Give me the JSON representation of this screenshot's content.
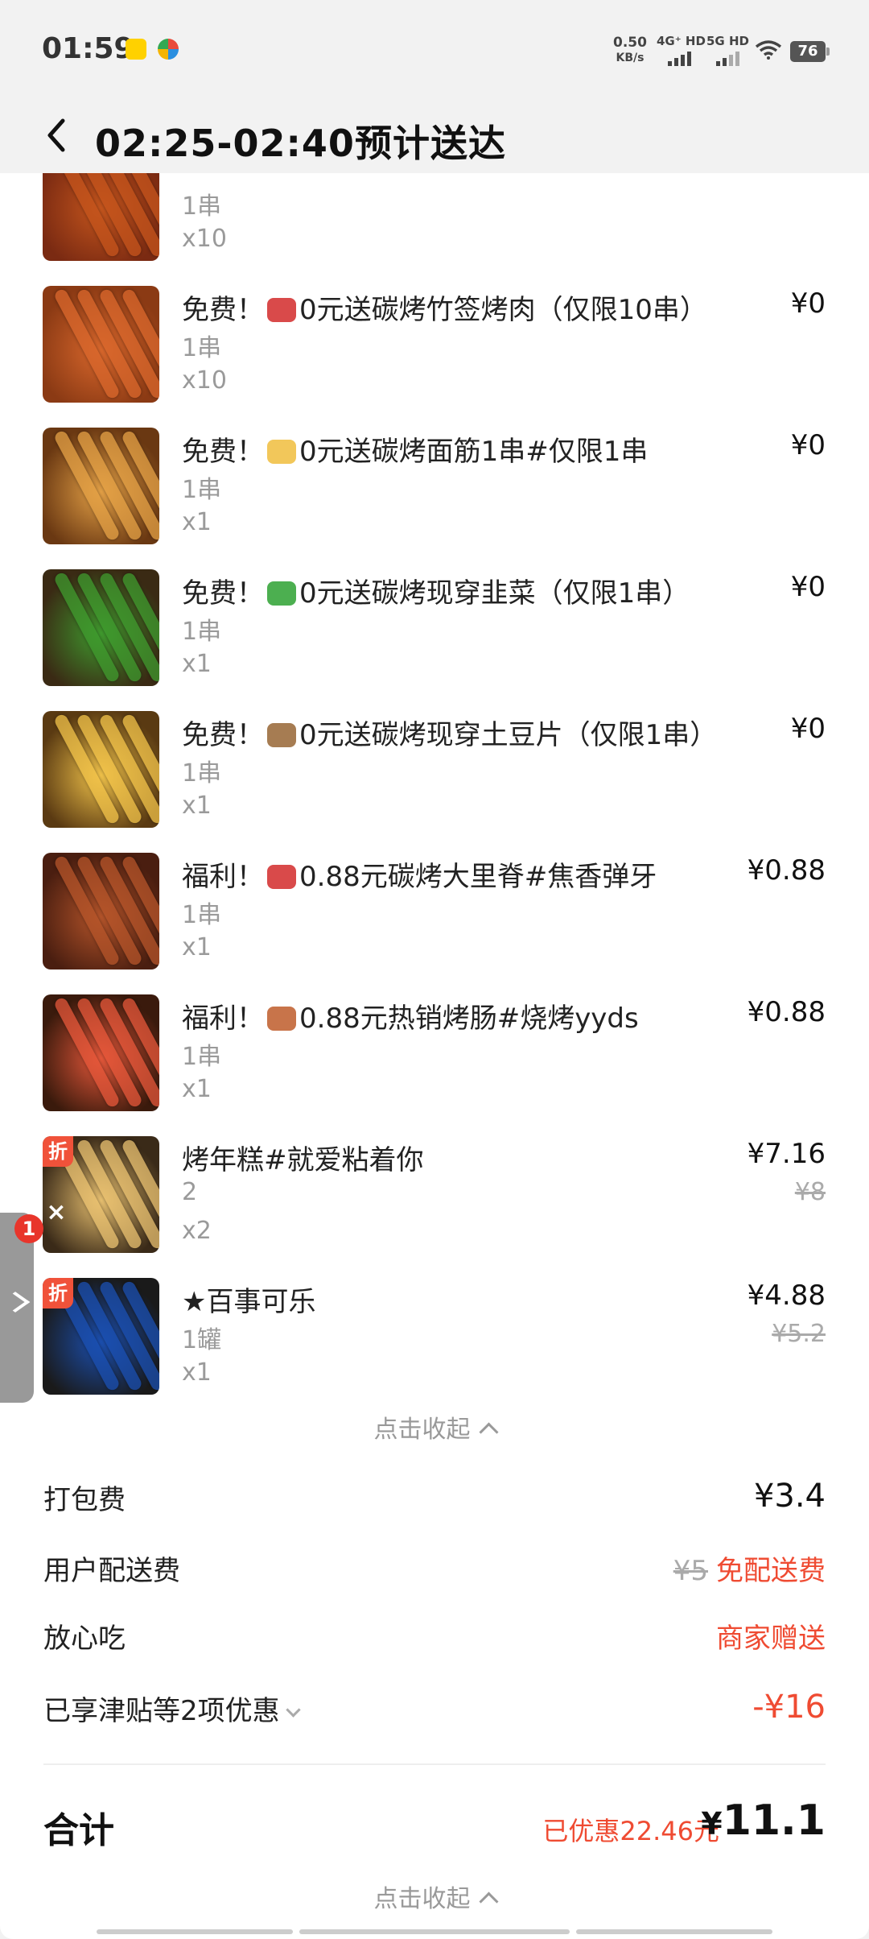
{
  "status_bar": {
    "time": "01:59",
    "net_speed_value": "0.50",
    "net_speed_unit": "KB/s",
    "sim1": "4G⁺ HD",
    "sim2": "5G HD",
    "battery": "76"
  },
  "header": {
    "title": "02:25-02:40预计送达"
  },
  "items": [
    {
      "name": "",
      "spec": "1串",
      "qty": "x10",
      "price": "",
      "orig_price": "",
      "discount": false,
      "colors": [
        "#7a2a12",
        "#c4551d"
      ]
    },
    {
      "name_pre": "免费！",
      "emoji_color": "#d94a4a",
      "name_post": "0元送碳烤竹签烤肉（仅限10串）",
      "spec": "1串",
      "qty": "x10",
      "price": "¥0",
      "orig_price": "",
      "discount": false,
      "colors": [
        "#8b3a14",
        "#d8672c"
      ]
    },
    {
      "name_pre": "免费！",
      "emoji_color": "#f2c75a",
      "name_post": "0元送碳烤面筋1串#仅限1串",
      "spec": "1串",
      "qty": "x1",
      "price": "¥0",
      "orig_price": "",
      "discount": false,
      "colors": [
        "#6a3812",
        "#e3a046"
      ]
    },
    {
      "name_pre": "免费！",
      "emoji_color": "#4caf50",
      "name_post": "0元送碳烤现穿韭菜（仅限1串）",
      "spec": "1串",
      "qty": "x1",
      "price": "¥0",
      "orig_price": "",
      "discount": false,
      "colors": [
        "#3a2a14",
        "#3f9a2e"
      ]
    },
    {
      "name_pre": "免费！",
      "emoji_color": "#a67c52",
      "name_post": "0元送碳烤现穿土豆片（仅限1串）",
      "spec": "1串",
      "qty": "x1",
      "price": "¥0",
      "orig_price": "",
      "discount": false,
      "colors": [
        "#5a3a12",
        "#f0c24a"
      ]
    },
    {
      "name_pre": "福利！",
      "emoji_color": "#d94a4a",
      "name_post": "0.88元碳烤大里脊#焦香弹牙",
      "spec": "1串",
      "qty": "x1",
      "price": "¥0.88",
      "orig_price": "",
      "discount": false,
      "colors": [
        "#4a1e10",
        "#b4542a"
      ]
    },
    {
      "name_pre": "福利！",
      "emoji_color": "#c8744a",
      "name_post": "0.88元热销烤肠#烧烤yyds",
      "spec": "1串",
      "qty": "x1",
      "price": "¥0.88",
      "orig_price": "",
      "discount": false,
      "colors": [
        "#3a1a0c",
        "#e4573a"
      ]
    },
    {
      "name_pre": "",
      "emoji_color": "",
      "name_post": "烤年糕#就爱粘着你",
      "spec": "2",
      "qty": "x2",
      "price": "¥7.16",
      "orig_price": "¥8",
      "discount": true,
      "colors": [
        "#3a2a18",
        "#e8c070"
      ]
    },
    {
      "name_pre": "",
      "emoji_color": "",
      "name_post": "★百事可乐",
      "spec": "1罐",
      "qty": "x1",
      "price": "¥4.88",
      "orig_price": "¥5.2",
      "discount": true,
      "colors": [
        "#1a1a1a",
        "#1b4fb0"
      ]
    }
  ],
  "discount_badge": "折",
  "collapse_label": "点击收起",
  "fees": {
    "packing_label": "打包费",
    "packing_value": "¥3.4",
    "delivery_label": "用户配送费",
    "delivery_orig": "¥5",
    "delivery_value": "免配送费",
    "safe_label": "放心吃",
    "safe_value": "商家赠送",
    "discount_label": "已享津贴等2项优惠",
    "discount_value": "-¥16"
  },
  "total": {
    "label": "合计",
    "saved": "已优惠22.46元",
    "yen": "¥",
    "amount": "11.1"
  },
  "side_badge": "1",
  "side_close": "×"
}
